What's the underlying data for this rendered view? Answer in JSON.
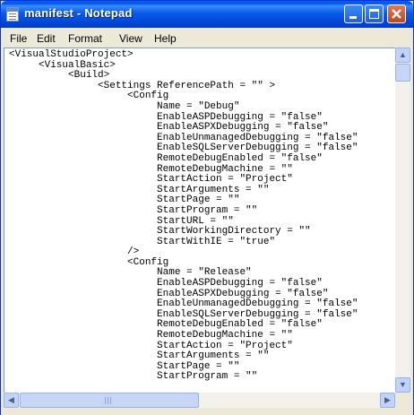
{
  "window": {
    "title": "manifest - Notepad"
  },
  "menu": {
    "file": "File",
    "edit": "Edit",
    "format": "Format",
    "view": "View",
    "help": "Help"
  },
  "editor": {
    "content": "<VisualStudioProject>\n     <VisualBasic>\n          <Build>\n               <Settings ReferencePath = \"\" >\n                    <Config\n                         Name = \"Debug\"\n                         EnableASPDebugging = \"false\"\n                         EnableASPXDebugging = \"false\"\n                         EnableUnmanagedDebugging = \"false\"\n                         EnableSQLServerDebugging = \"false\"\n                         RemoteDebugEnabled = \"false\"\n                         RemoteDebugMachine = \"\"\n                         StartAction = \"Project\"\n                         StartArguments = \"\"\n                         StartPage = \"\"\n                         StartProgram = \"\"\n                         StartURL = \"\"\n                         StartWorkingDirectory = \"\"\n                         StartWithIE = \"true\"\n                    />\n                    <Config\n                         Name = \"Release\"\n                         EnableASPDebugging = \"false\"\n                         EnableASPXDebugging = \"false\"\n                         EnableUnmanagedDebugging = \"false\"\n                         EnableSQLServerDebugging = \"false\"\n                         RemoteDebugEnabled = \"false\"\n                         RemoteDebugMachine = \"\"\n                         StartAction = \"Project\"\n                         StartArguments = \"\"\n                         StartPage = \"\"\n                         StartProgram = \"\"\n"
  },
  "colors": {
    "titlebar": "#0058e6",
    "editor_bg": "#ffffff",
    "chrome": "#ece9d8"
  },
  "icons": {
    "app": "notepad-icon",
    "minimize": "minimize-icon",
    "maximize": "maximize-icon",
    "close": "close-icon"
  }
}
